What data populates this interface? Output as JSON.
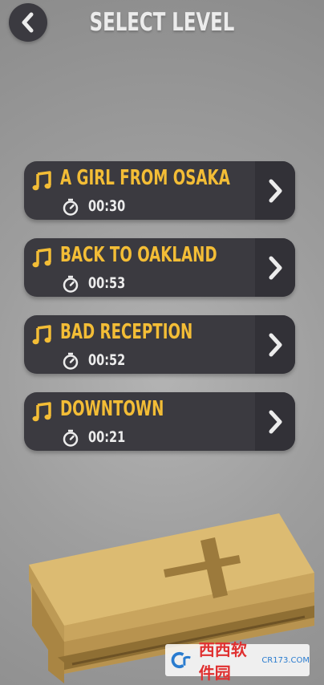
{
  "header": {
    "title": "SELECT LEVEL",
    "back_icon": "chevron-left-icon"
  },
  "levels": [
    {
      "name": "A GIRL FROM OSAKA",
      "duration": "00:30"
    },
    {
      "name": "BACK TO OAKLAND",
      "duration": "00:53"
    },
    {
      "name": "BAD RECEPTION",
      "duration": "00:52"
    },
    {
      "name": "DOWNTOWN",
      "duration": "00:21"
    }
  ],
  "watermark": {
    "brand": "西西软件园",
    "site": "CR173.COM"
  },
  "colors": {
    "card": "#3b3a40",
    "card_right": "#323137",
    "accent": "#f3bd36",
    "text": "#ececec"
  }
}
